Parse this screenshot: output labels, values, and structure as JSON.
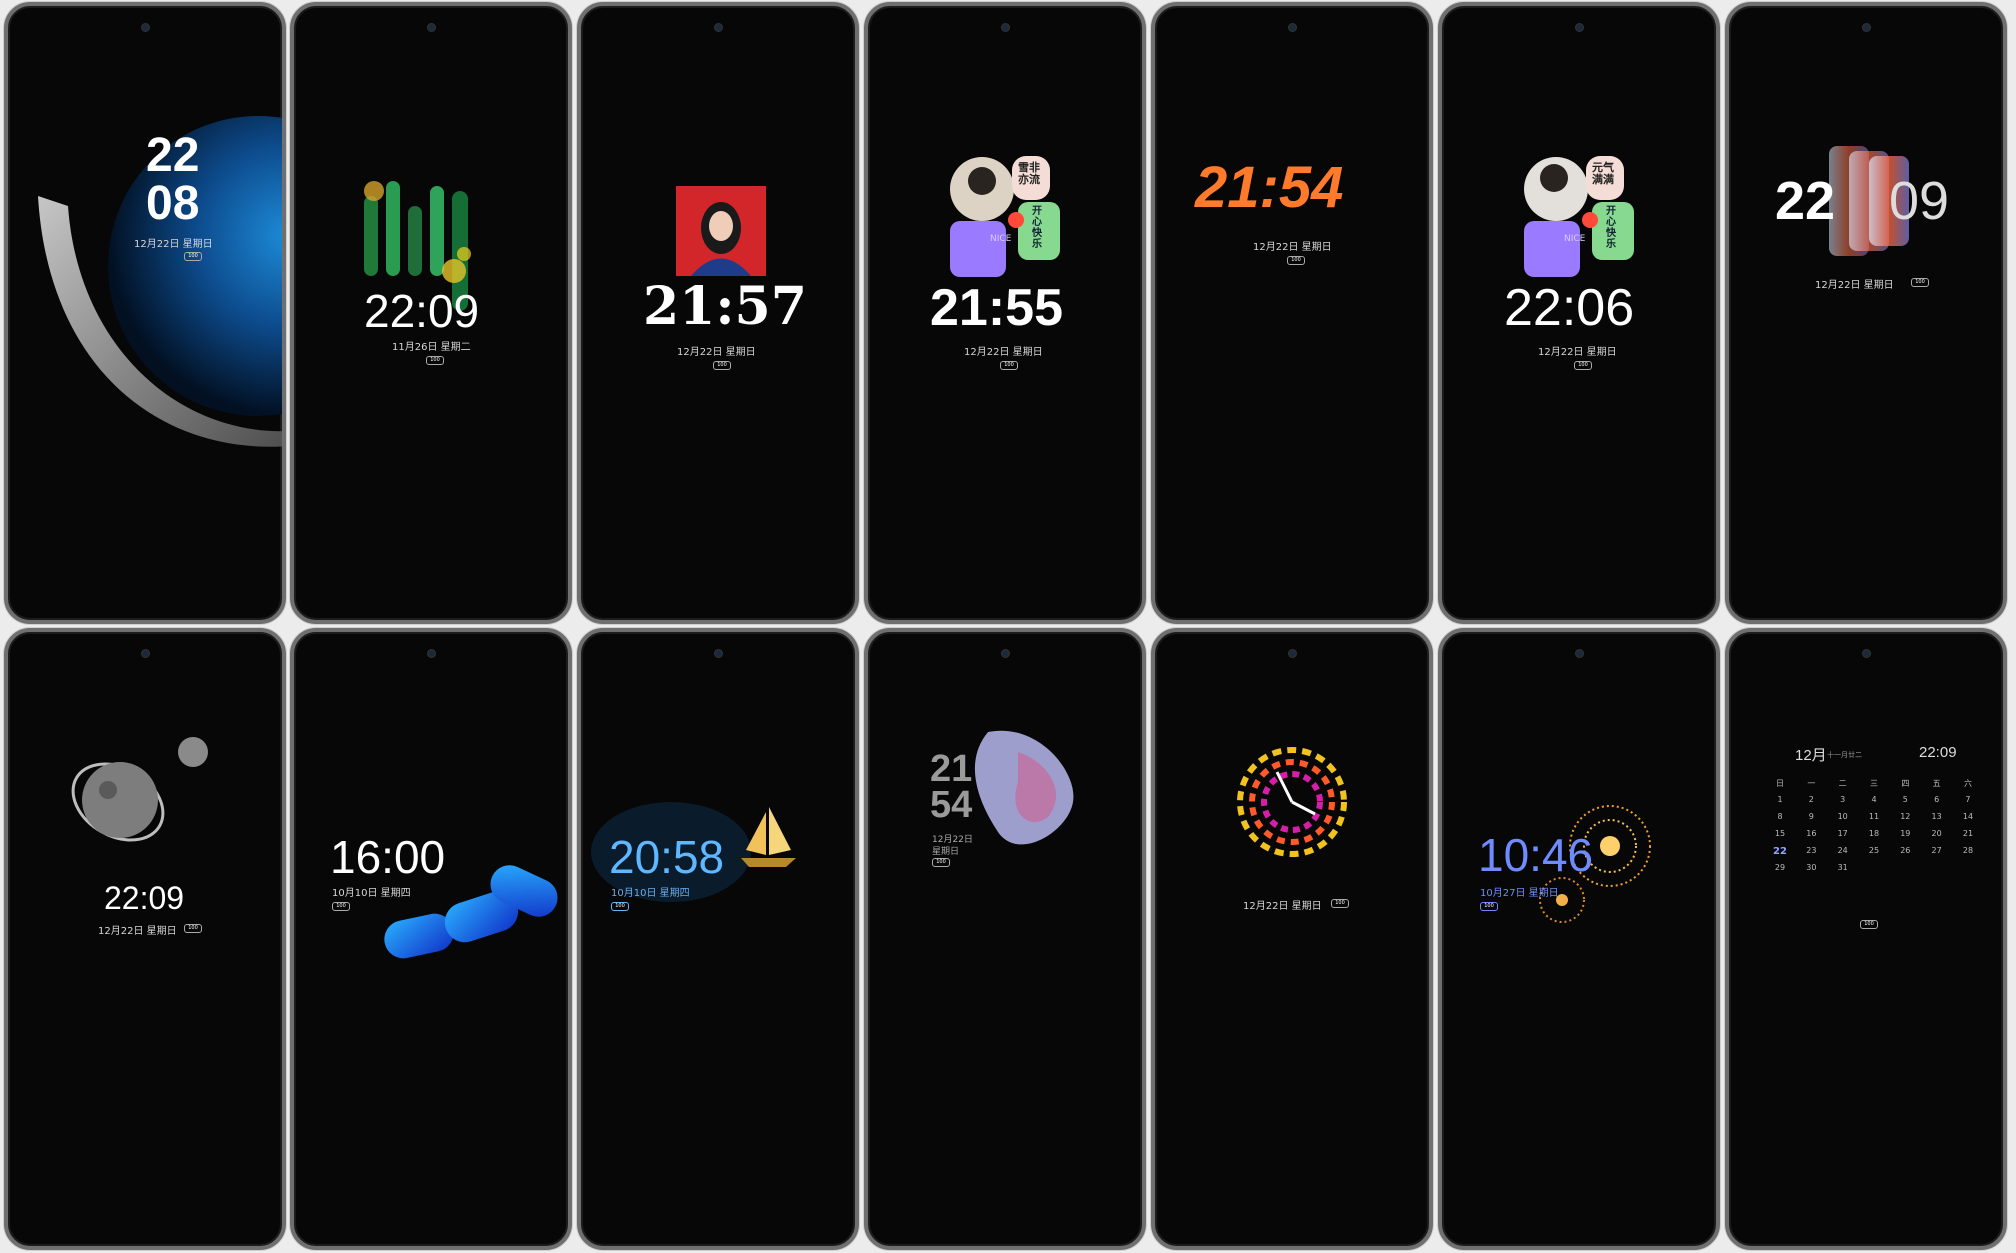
{
  "phones": [
    {
      "time_a": "22",
      "time_b": "08",
      "date": "12月22日 星期日",
      "battery": "100"
    },
    {
      "time": "22:09",
      "date": "11月26日 星期二",
      "battery": "100"
    },
    {
      "time": "21:57",
      "date": "12月22日 星期日",
      "battery": "100"
    },
    {
      "time": "21:55",
      "date": "12月22日 星期日",
      "battery": "100",
      "sticker_a": "雪非\n亦流",
      "sticker_b": "开心快乐",
      "sticker_c": "NICE"
    },
    {
      "time": "21:54",
      "date": "12月22日 星期日",
      "battery": "100"
    },
    {
      "time": "22:06",
      "date": "12月22日 星期日",
      "battery": "100",
      "sticker_a": "元气\n满满",
      "sticker_b": "开心快乐",
      "sticker_c": "NICE"
    },
    {
      "time_a": "22",
      "time_b": "09",
      "date": "12月22日 星期日",
      "battery": "100"
    },
    {
      "time": "22:09",
      "date": "12月22日 星期日",
      "battery": "100"
    },
    {
      "time": "16:00",
      "date": "10月10日 星期四",
      "battery": "100"
    },
    {
      "time": "20:58",
      "date": "10月10日 星期四",
      "battery": "100"
    },
    {
      "time_a": "21",
      "time_b": "54",
      "date_a": "12月22日",
      "date_b": "星期日",
      "battery": "100"
    },
    {
      "date": "12月22日 星期日",
      "battery": "100"
    },
    {
      "time": "10:46",
      "date": "10月27日 星期日",
      "battery": "100"
    },
    {
      "month": "12月",
      "lunar": "十一月廿二",
      "time": "22:09",
      "battery": "100",
      "weekdays": [
        "日",
        "一",
        "二",
        "三",
        "四",
        "五",
        "六"
      ],
      "weeks": [
        [
          "1",
          "2",
          "3",
          "4",
          "5",
          "6",
          "7"
        ],
        [
          "8",
          "9",
          "10",
          "11",
          "12",
          "13",
          "14"
        ],
        [
          "15",
          "16",
          "17",
          "18",
          "19",
          "20",
          "21"
        ],
        [
          "22",
          "23",
          "24",
          "25",
          "26",
          "27",
          "28"
        ],
        [
          "29",
          "30",
          "31",
          "",
          "",
          "",
          ""
        ]
      ]
    }
  ],
  "colors": {
    "accent_blue": "#6f8cff",
    "orange": "#ff7a2a",
    "calendar_today": "#8fa6ff"
  }
}
